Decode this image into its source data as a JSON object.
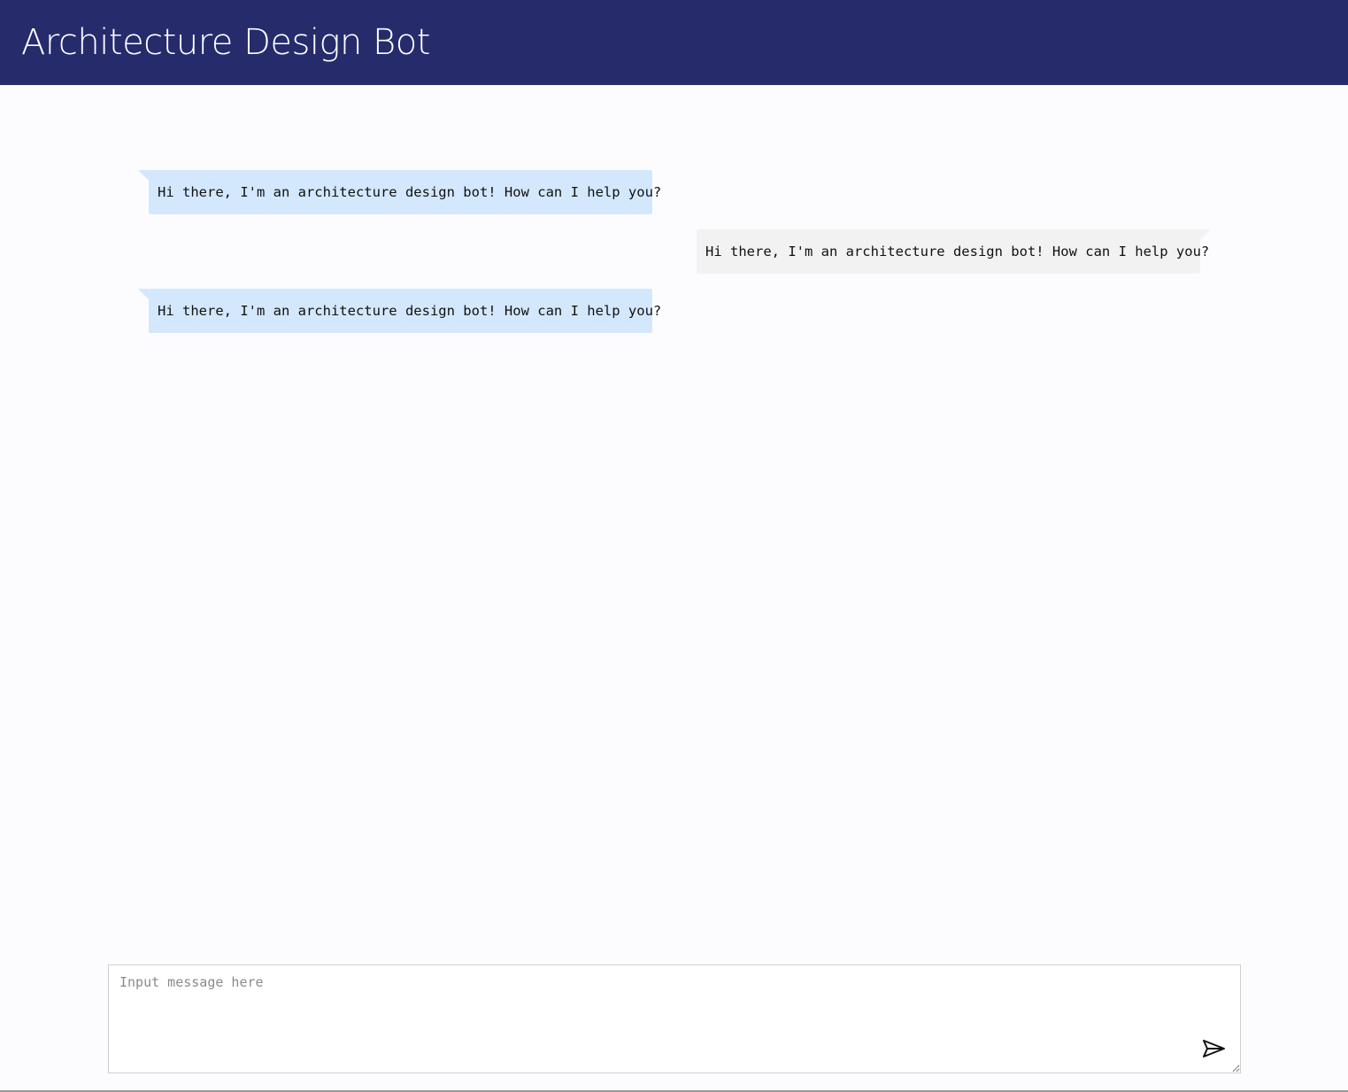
{
  "header": {
    "title": "Architecture Design Bot"
  },
  "chat": {
    "messages": [
      {
        "role": "bot",
        "text": "Hi there, I'm an architecture design bot! How can I help you?"
      },
      {
        "role": "user",
        "text": "Hi there, I'm an architecture design bot! How can I help you?"
      },
      {
        "role": "bot",
        "text": "Hi there, I'm an architecture design bot! How can I help you?"
      }
    ]
  },
  "composer": {
    "placeholder": "Input message here",
    "value": "",
    "send_icon": "send-icon"
  },
  "colors": {
    "header_bg": "#262b6c",
    "bot_bubble": "#d3e8fd",
    "user_bubble": "#f2f2f2",
    "page_bg": "#fcfcff"
  }
}
